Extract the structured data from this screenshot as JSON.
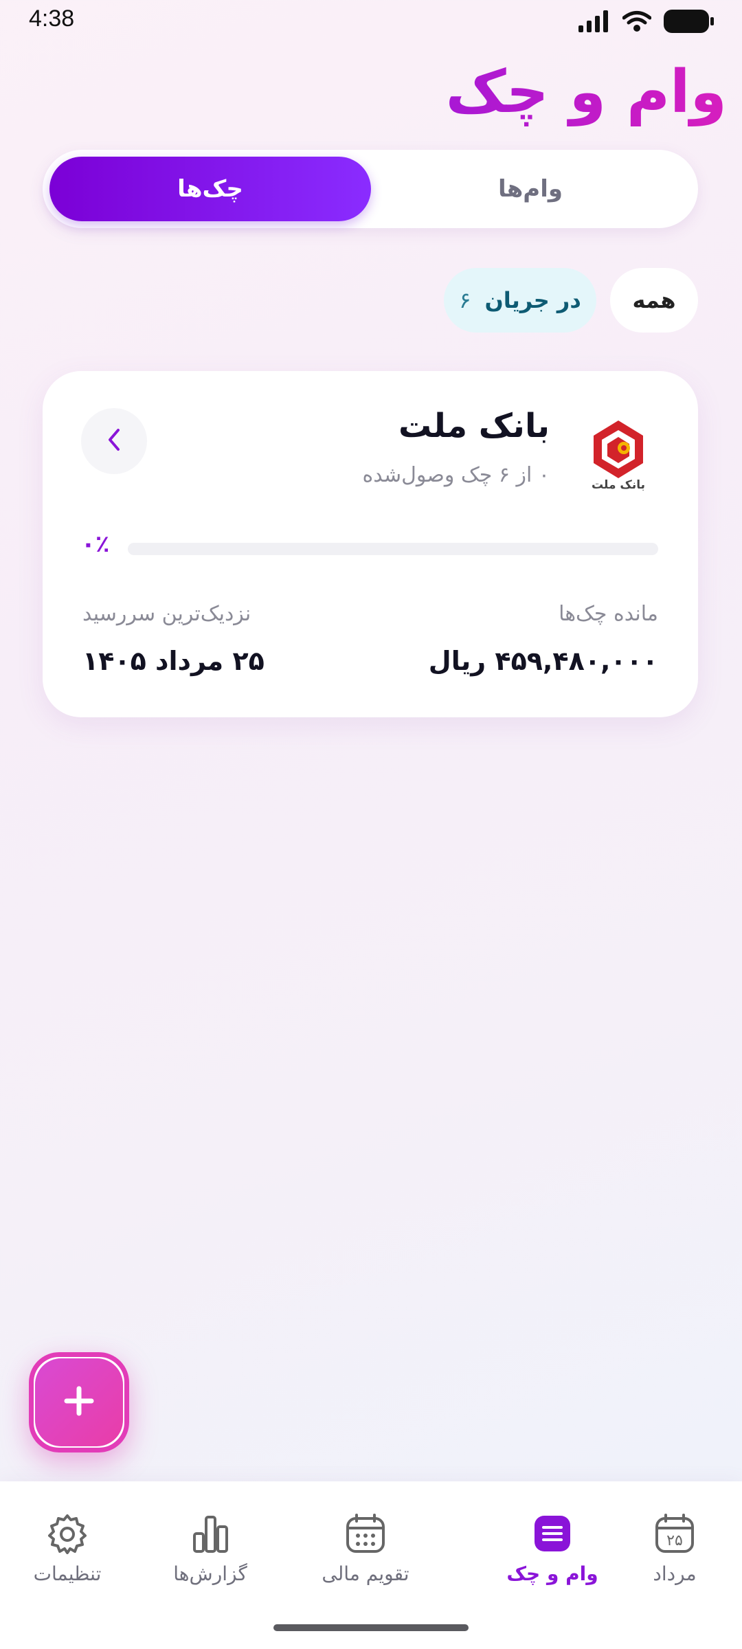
{
  "status_bar": {
    "time": "4:38",
    "icons": [
      "signal-icon",
      "wifi-icon",
      "battery-icon"
    ]
  },
  "page": {
    "title": "وام و چک"
  },
  "tabs": {
    "loans": "وام‌ها",
    "checks": "چک‌ها",
    "active": "checks"
  },
  "filters": {
    "all": "همه",
    "in_progress": "در جریان",
    "in_progress_count": "۶",
    "active": "in_progress"
  },
  "card": {
    "logo_text": "بانک ملت",
    "bank_name": "بانک ملت",
    "subtitle": "۰ از ۶ چک وصول‌شده",
    "progress_label": "۰٪",
    "progress_fraction": 0,
    "balance_label": "مانده چک‌ها",
    "balance_value": "۴۵۹,۴۸۰,۰۰۰ ریال",
    "nearest_due_label": "نزدیک‌ترین سررسید",
    "nearest_due_value": "۲۵ مرداد ۱۴۰۵"
  },
  "fab": {
    "icon": "plus-icon"
  },
  "bottom_nav": {
    "items": [
      {
        "label": "مرداد",
        "icon": "calendar-date-icon",
        "badge": "۲۵"
      },
      {
        "label": "وام و چک",
        "icon": "list-icon",
        "active": true
      },
      {
        "label": "تقویم مالی",
        "icon": "calendar-icon"
      },
      {
        "label": "گزارش‌ها",
        "icon": "bar-chart-icon"
      },
      {
        "label": "تنظیمات",
        "icon": "gear-icon"
      }
    ]
  },
  "colors": {
    "accent": "#8a14d8",
    "title_gradient": [
      "#a818d4",
      "#d61ebe"
    ],
    "chip_active_bg": "#e4f6fa",
    "fab_gradient": [
      "#d94ad3",
      "#e93da8"
    ],
    "bank_red": "#d2232a"
  }
}
